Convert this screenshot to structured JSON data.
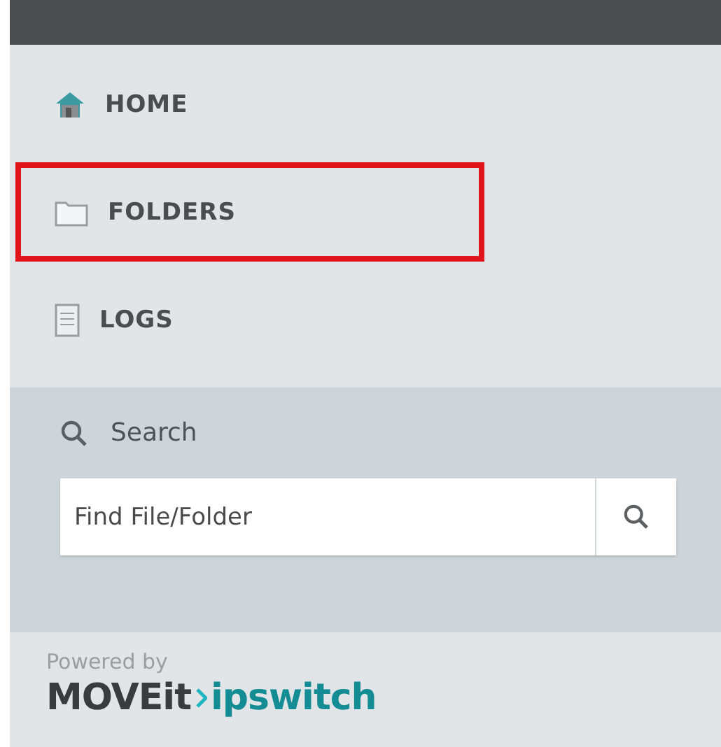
{
  "nav": [
    {
      "label": "HOME",
      "kind": "home",
      "highlighted": false
    },
    {
      "label": "FOLDERS",
      "kind": "folder",
      "highlighted": true
    },
    {
      "label": "LOGS",
      "kind": "log",
      "highlighted": false
    }
  ],
  "search": {
    "heading": "Search",
    "placeholder": "Find File/Folder"
  },
  "footer": {
    "powered_by": "Powered by",
    "product": "MOVEit",
    "company": "ipswitch"
  }
}
